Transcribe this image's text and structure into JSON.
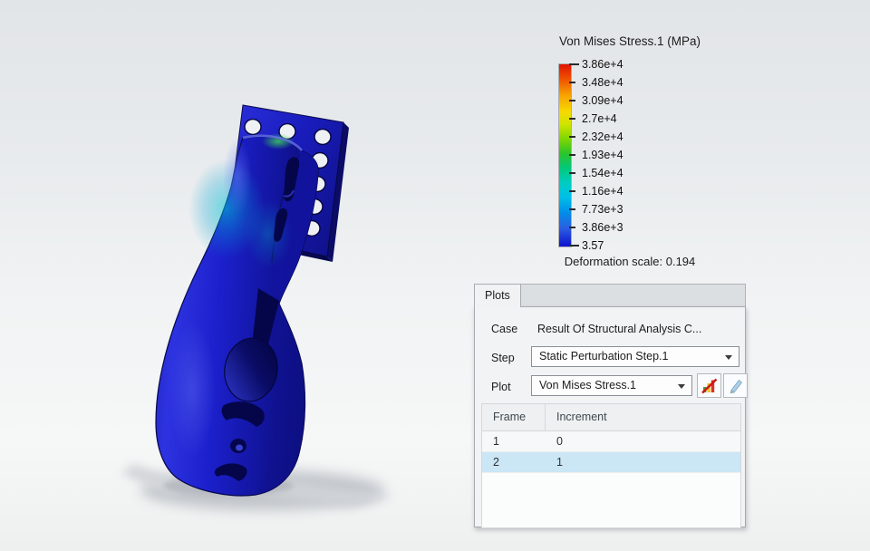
{
  "viewport": {
    "background_top": "#e2e5e8",
    "background_bottom": "#eff1f1"
  },
  "legend": {
    "title": "Von Mises Stress.1 (MPa)",
    "ticks": [
      "3.86e+4",
      "3.48e+4",
      "3.09e+4",
      "2.7e+4",
      "2.32e+4",
      "1.93e+4",
      "1.54e+4",
      "1.16e+4",
      "7.73e+3",
      "3.86e+3",
      "3.57"
    ],
    "deformation_label": "Deformation scale: 0.194",
    "colorbar_top_color": "#e01400",
    "colorbar_bottom_color": "#0d12cf"
  },
  "model": {
    "name": "bracket-part-von-mises",
    "dominant_stress_color": "#1a1ec6"
  },
  "panel": {
    "tab_label": "Plots",
    "case_label": "Case",
    "case_value": "Result Of Structural Analysis C...",
    "step_label": "Step",
    "step_value": "Static Perturbation Step.1",
    "plot_label": "Plot",
    "plot_value": "Von Mises Stress.1",
    "icons": {
      "step_dropdown": "chevron-down",
      "plot_dropdown": "chevron-down",
      "toggle_plot": "chart-red-cross",
      "edit_plot": "pencil"
    },
    "table": {
      "headers": [
        "Frame",
        "Increment"
      ],
      "rows": [
        [
          "1",
          "0"
        ],
        [
          "2",
          "1"
        ]
      ],
      "selected_row_index": 1,
      "selection_color": "#cbe6f5"
    }
  }
}
